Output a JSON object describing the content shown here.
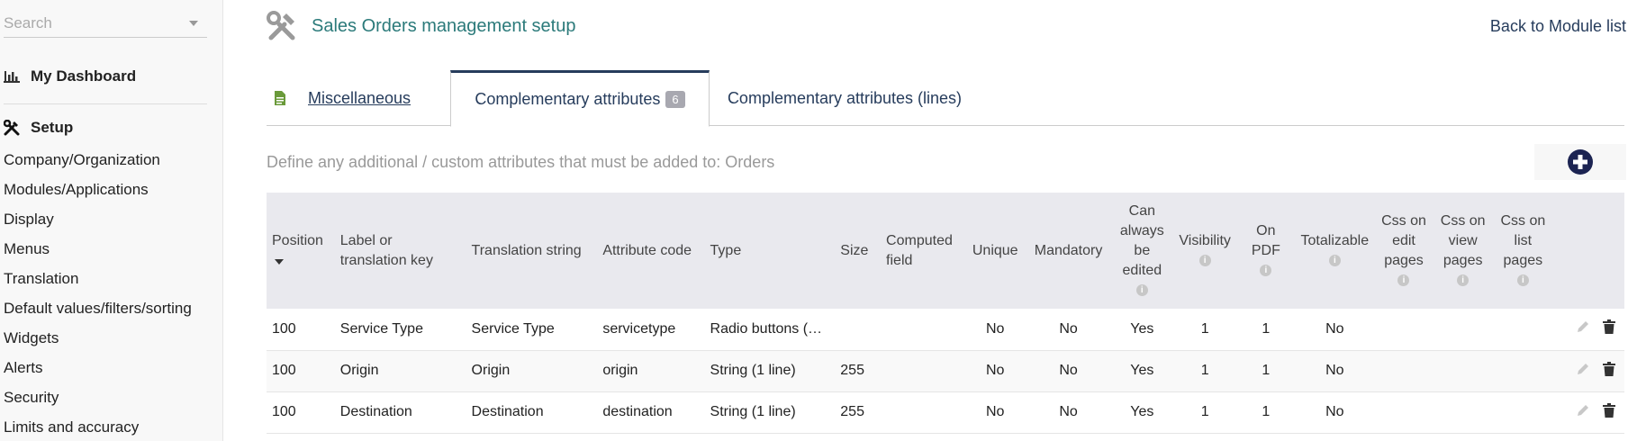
{
  "sidebar": {
    "search_placeholder": "Search",
    "dashboard_label": "My Dashboard",
    "setup_label": "Setup",
    "items": [
      {
        "label": "Company/Organization"
      },
      {
        "label": "Modules/Applications"
      },
      {
        "label": "Display"
      },
      {
        "label": "Menus"
      },
      {
        "label": "Translation"
      },
      {
        "label": "Default values/filters/sorting"
      },
      {
        "label": "Widgets"
      },
      {
        "label": "Alerts"
      },
      {
        "label": "Security"
      },
      {
        "label": "Limits and accuracy"
      }
    ]
  },
  "header": {
    "title": "Sales Orders management setup",
    "back_link": "Back to Module list"
  },
  "tabs": [
    {
      "label": "Miscellaneous"
    },
    {
      "label": "Complementary attributes",
      "badge": "6"
    },
    {
      "label": "Complementary attributes (lines)"
    }
  ],
  "description": "Define any additional / custom attributes that must be added to: Orders",
  "table": {
    "headers": {
      "position": "Position",
      "label_key": "Label or translation key",
      "translation": "Translation string",
      "code": "Attribute code",
      "type": "Type",
      "size": "Size",
      "computed": "Computed field",
      "unique": "Unique",
      "mandatory": "Mandatory",
      "always_edit": "Can always be edited",
      "visibility": "Visibility",
      "on_pdf": "On PDF",
      "totalizable": "Totalizable",
      "css_edit": "Css on edit pages",
      "css_view": "Css on view pages",
      "css_list": "Css on list pages"
    },
    "rows": [
      {
        "position": "100",
        "label": "Service Type",
        "translation": "Service Type",
        "code": "servicetype",
        "type": "Radio buttons (…",
        "size": "",
        "computed": "",
        "unique": "No",
        "mandatory": "No",
        "always_edit": "Yes",
        "visibility": "1",
        "on_pdf": "1",
        "totalizable": "No"
      },
      {
        "position": "100",
        "label": "Origin",
        "translation": "Origin",
        "code": "origin",
        "type": "String (1 line)",
        "size": "255",
        "computed": "",
        "unique": "No",
        "mandatory": "No",
        "always_edit": "Yes",
        "visibility": "1",
        "on_pdf": "1",
        "totalizable": "No"
      },
      {
        "position": "100",
        "label": "Destination",
        "translation": "Destination",
        "code": "destination",
        "type": "String (1 line)",
        "size": "255",
        "computed": "",
        "unique": "No",
        "mandatory": "No",
        "always_edit": "Yes",
        "visibility": "1",
        "on_pdf": "1",
        "totalizable": "No"
      }
    ]
  },
  "colors": {
    "accent_dark": "#263c5c",
    "title_teal": "#2b7a7a",
    "badge_gray": "#a8a8b0"
  }
}
